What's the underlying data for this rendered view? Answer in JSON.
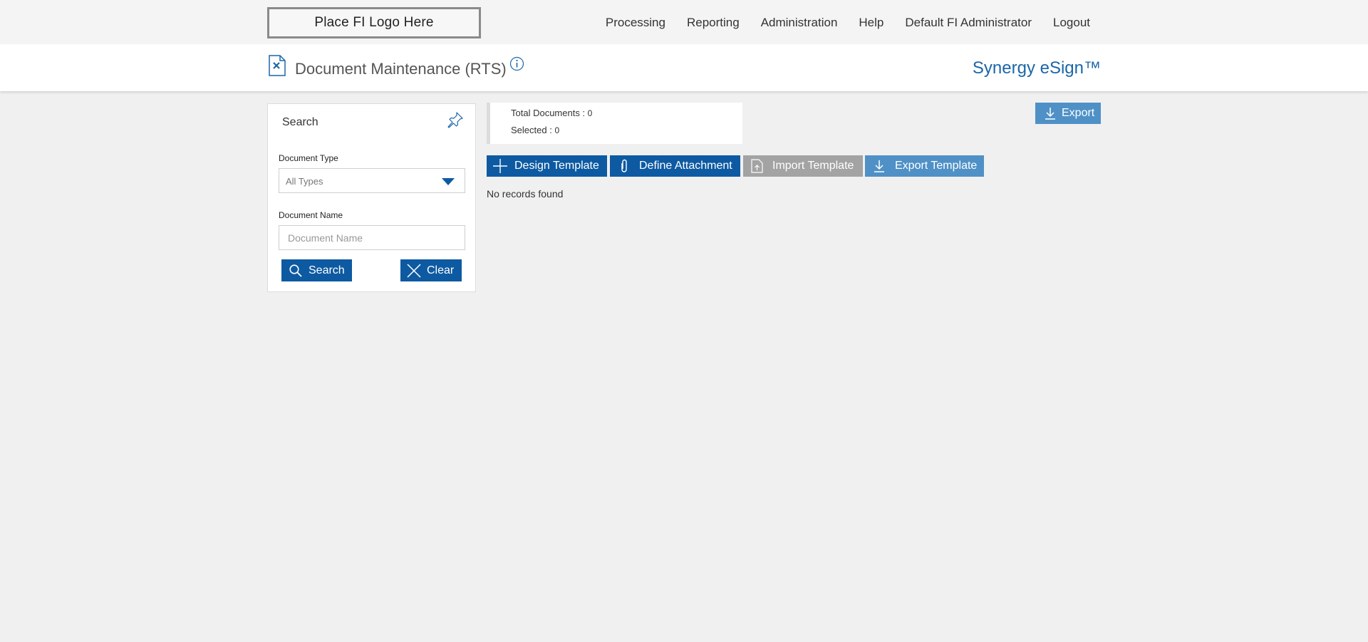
{
  "topbar": {
    "logo_text": "Place FI Logo Here",
    "nav": [
      "Processing",
      "Reporting",
      "Administration",
      "Help",
      "Default FI Administrator",
      "Logout"
    ]
  },
  "header": {
    "title": "Document Maintenance (RTS)",
    "brand": "Synergy eSign™",
    "icons": [
      "document-icon",
      "info-icon"
    ]
  },
  "search_panel": {
    "title": "Search",
    "document_type_label": "Document Type",
    "document_type_value": "All Types",
    "document_name_label": "Document Name",
    "document_name_placeholder": "Document Name",
    "document_name_value": "",
    "search_label": "Search",
    "clear_label": "Clear",
    "icons": [
      "pin-icon",
      "chevron-down-icon",
      "search-icon",
      "close-icon"
    ]
  },
  "summary": {
    "total_label": "Total Documents :",
    "total_value": "0",
    "selected_label": "Selected :",
    "selected_value": "0"
  },
  "toolbar": {
    "export_label": "Export",
    "design_template_label": "Design Template",
    "define_attachment_label": "Define Attachment",
    "import_template_label": "Import Template",
    "export_template_label": "Export Template"
  },
  "results": {
    "empty_message": "No records found"
  },
  "colors": {
    "primary": "#0d5aa2",
    "light_button": "#4f91c7",
    "disabled_button": "#a3a3a3",
    "brand_text": "#1b66a8",
    "background": "#f0f0f0"
  }
}
